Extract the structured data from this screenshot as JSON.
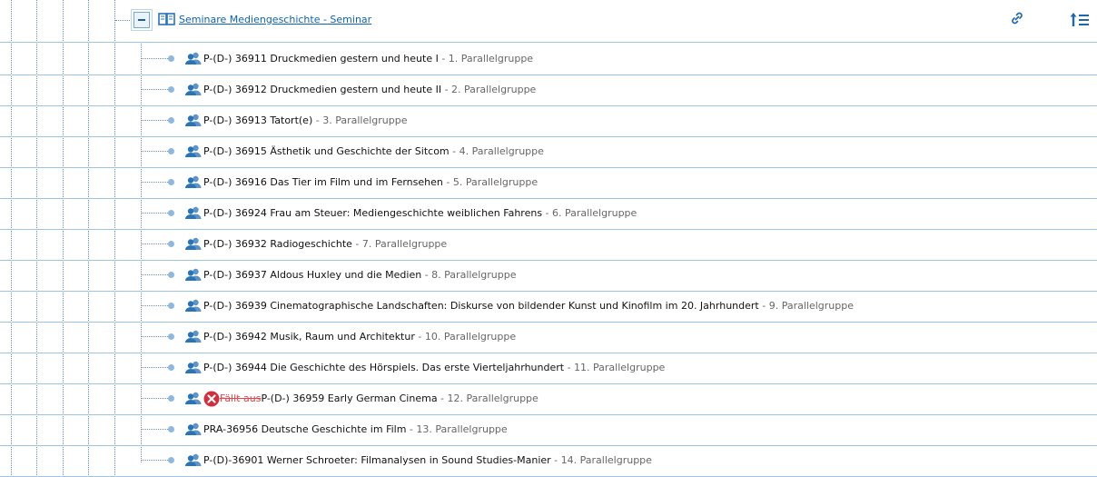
{
  "header": {
    "title": "Seminare Mediengeschichte - Seminar"
  },
  "rows": [
    {
      "title": "P-(D-) 36911 Druckmedien gestern und heute I",
      "group": " - 1. Parallelgruppe",
      "status": ""
    },
    {
      "title": "P-(D-) 36912 Druckmedien gestern und heute II",
      "group": " - 2. Parallelgruppe",
      "status": ""
    },
    {
      "title": "P-(D-) 36913 Tatort(e)",
      "group": " - 3. Parallelgruppe",
      "status": ""
    },
    {
      "title": "P-(D-) 36915 Ästhetik und Geschichte der Sitcom",
      "group": " - 4. Parallelgruppe",
      "status": ""
    },
    {
      "title": "P-(D-) 36916 Das Tier im Film und im Fernsehen",
      "group": " - 5. Parallelgruppe",
      "status": ""
    },
    {
      "title": "P-(D-) 36924 Frau am Steuer: Mediengeschichte weiblichen Fahrens",
      "group": " - 6. Parallelgruppe",
      "status": ""
    },
    {
      "title": "P-(D-) 36932 Radiogeschichte",
      "group": " - 7. Parallelgruppe",
      "status": ""
    },
    {
      "title": "P-(D-) 36937 Aldous Huxley und die Medien",
      "group": " - 8. Parallelgruppe",
      "status": ""
    },
    {
      "title": "P-(D-) 36939 Cinematographische Landschaften: Diskurse von bildender Kunst und Kinofilm im 20. Jahrhundert",
      "group": " - 9. Parallelgruppe",
      "status": ""
    },
    {
      "title": "P-(D-) 36942 Musik, Raum und Architektur",
      "group": " - 10. Parallelgruppe",
      "status": ""
    },
    {
      "title": "P-(D-) 36944 Die Geschichte des Hörspiels. Das erste Vierteljahrhundert",
      "group": " - 11. Parallelgruppe",
      "status": ""
    },
    {
      "title": "P-(D-) 36959 Early German Cinema",
      "group": " - 12. Parallelgruppe",
      "status": "Fällt aus"
    },
    {
      "title": "PRA-36956 Deutsche Geschichte im Film",
      "group": " - 13. Parallelgruppe",
      "status": ""
    },
    {
      "title": "P-(D)-36901 Werner Schroeter: Filmanalysen in Sound Studies-Manier",
      "group": " - 14. Parallelgruppe",
      "status": ""
    }
  ],
  "colors": {
    "link": "#0b63b3",
    "row_border": "#9cc4e4",
    "people_icon": "#2a73b5",
    "cancel_icon": "#d12f3c",
    "cancel_text": "#e0484d",
    "group_text": "#666666"
  },
  "icons": {
    "toggle": "collapse-minus-icon",
    "book": "book-icon",
    "link": "link-icon",
    "sort": "sort-icon",
    "row": "people-icon",
    "cancelled": "cancel-icon"
  }
}
